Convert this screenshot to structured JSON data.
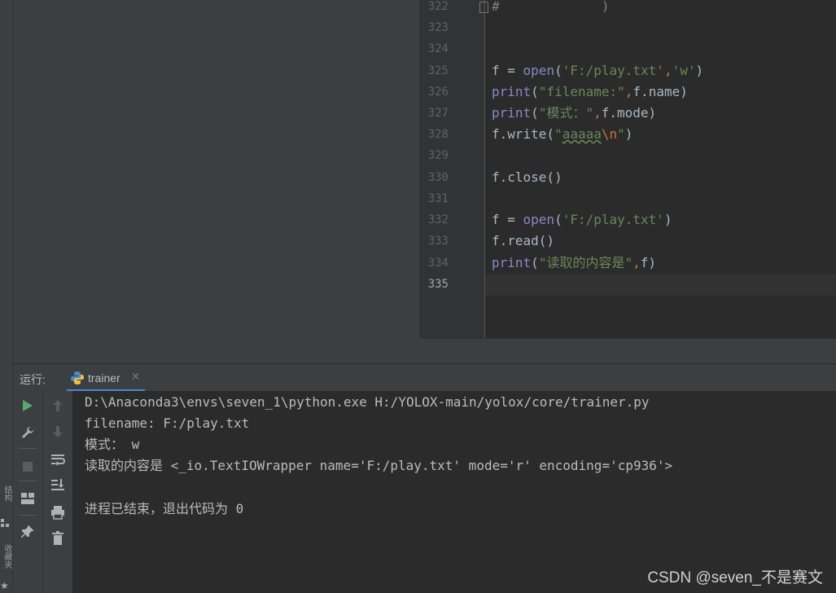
{
  "editor": {
    "lines": [
      {
        "num": "322",
        "text": "#             )"
      },
      {
        "num": "323",
        "text": ""
      },
      {
        "num": "324",
        "text": ""
      },
      {
        "num": "325",
        "text": "f = open('F:/play.txt','w')"
      },
      {
        "num": "326",
        "text": "print(\"filename:\",f.name)"
      },
      {
        "num": "327",
        "text": "print(\"模式：\",f.mode)"
      },
      {
        "num": "328",
        "text": "f.write(\"aaaaa\\n\")"
      },
      {
        "num": "329",
        "text": ""
      },
      {
        "num": "330",
        "text": "f.close()"
      },
      {
        "num": "331",
        "text": ""
      },
      {
        "num": "332",
        "text": "f = open('F:/play.txt')"
      },
      {
        "num": "333",
        "text": "f.read()"
      },
      {
        "num": "334",
        "text": "print(\"读取的内容是\",f)"
      },
      {
        "num": "335",
        "text": ""
      }
    ]
  },
  "run": {
    "label": "运行:",
    "tab_title": "trainer",
    "tab_close": "×"
  },
  "console": {
    "lines": [
      "D:\\Anaconda3\\envs\\seven_1\\python.exe H:/YOLOX-main/yolox/core/trainer.py",
      "filename: F:/play.txt",
      "模式： w",
      "读取的内容是 <_io.TextIOWrapper name='F:/play.txt' mode='r' encoding='cp936'>",
      "",
      "进程已结束，退出代码为 0"
    ]
  },
  "side": {
    "structure": "结构",
    "favorites": "收藏夹"
  },
  "watermark": "CSDN @seven_不是赛文",
  "colors": {
    "keyword_builtin": "#8888c6",
    "string": "#6a8759",
    "escape": "#cc7832",
    "run_green": "#59a869"
  }
}
